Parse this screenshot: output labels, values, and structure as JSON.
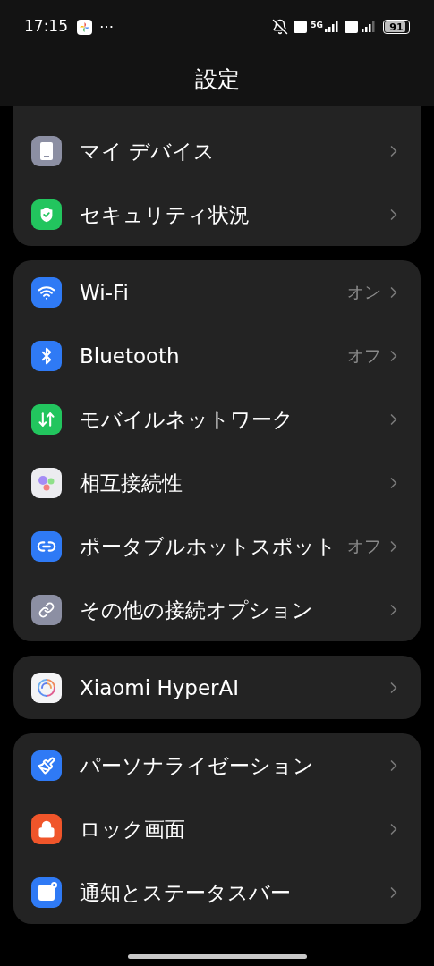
{
  "status_bar": {
    "time": "17:15",
    "more": "⋯",
    "network": "5G",
    "battery": "91",
    "level": 0.91
  },
  "header": {
    "title": "設定"
  },
  "groups": [
    {
      "items": [
        {
          "label": "マイ デバイス"
        },
        {
          "label": "セキュリティ状況"
        }
      ]
    },
    {
      "items": [
        {
          "label": "Wi-Fi",
          "value": "オン"
        },
        {
          "label": "Bluetooth",
          "value": "オフ"
        },
        {
          "label": "モバイルネットワーク"
        },
        {
          "label": "相互接続性"
        },
        {
          "label": "ポータブルホットスポット",
          "value": "オフ"
        },
        {
          "label": "その他の接続オプション"
        }
      ]
    },
    {
      "items": [
        {
          "label": "Xiaomi HyperAI"
        }
      ]
    },
    {
      "items": [
        {
          "label": "パーソナライゼーション"
        },
        {
          "label": "ロック画面"
        },
        {
          "label": "通知とステータスバー"
        }
      ]
    }
  ]
}
